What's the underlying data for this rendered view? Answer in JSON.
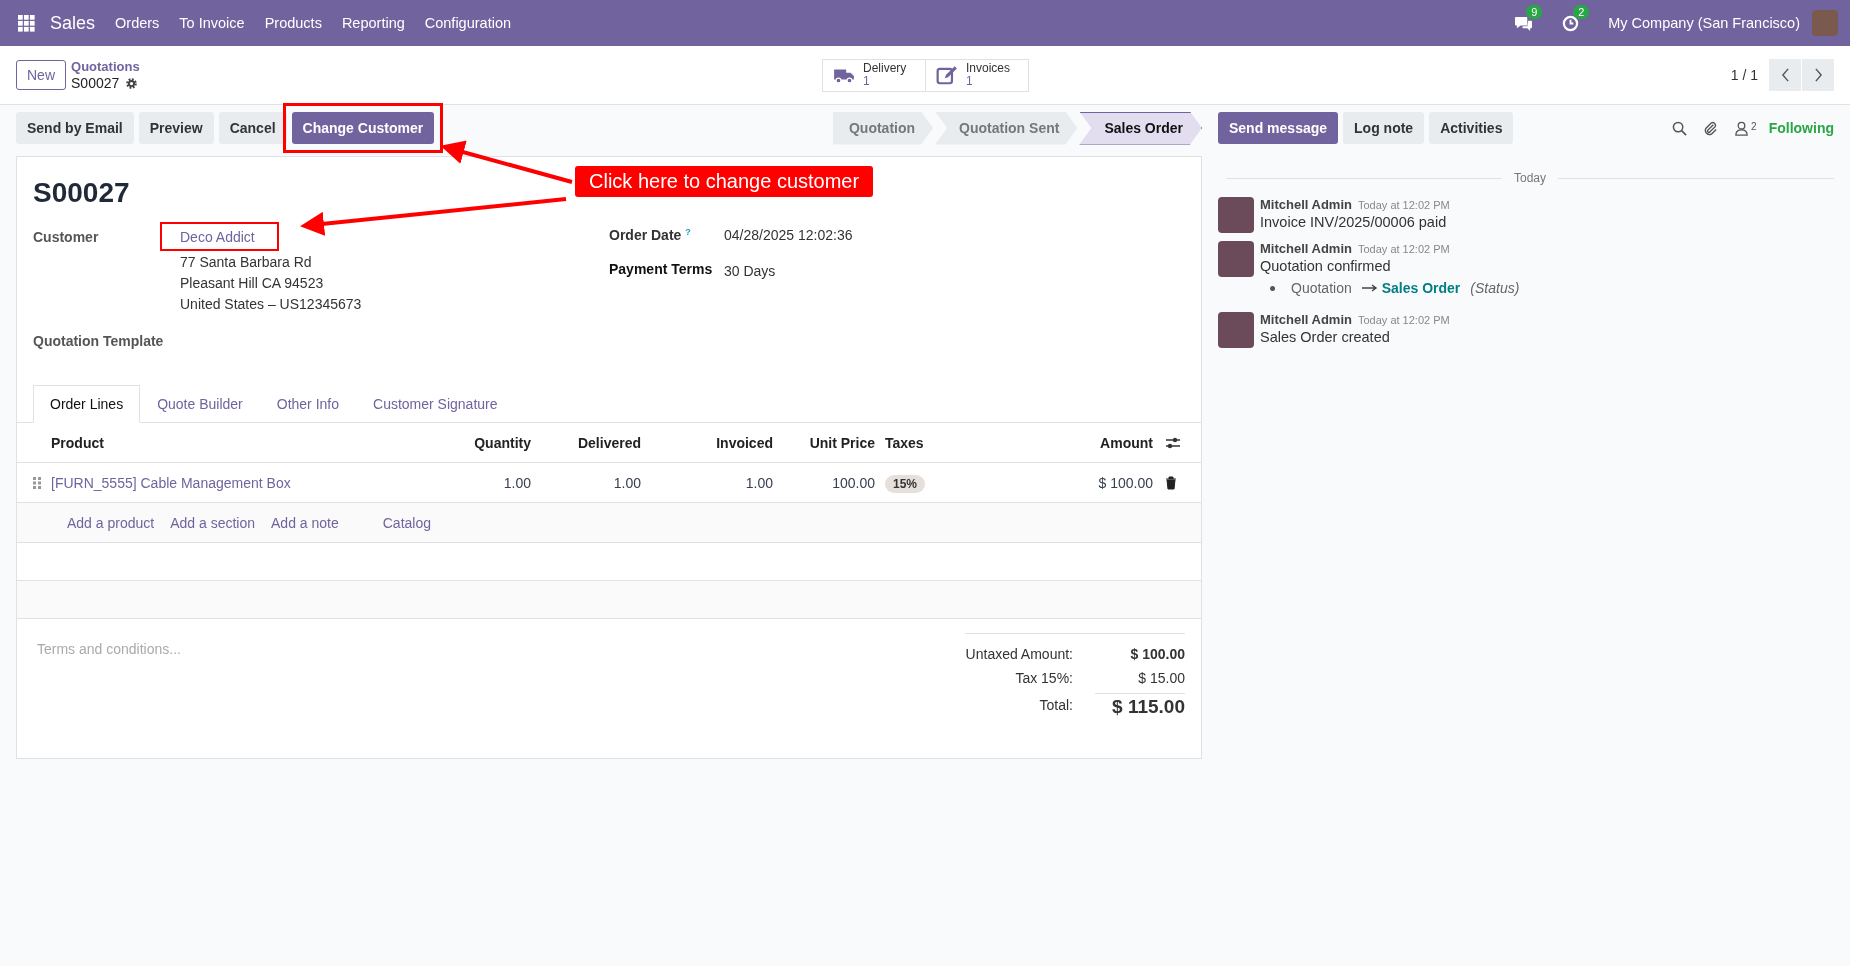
{
  "navbar": {
    "app": "Sales",
    "menu": [
      "Orders",
      "To Invoice",
      "Products",
      "Reporting",
      "Configuration"
    ],
    "messages_badge": "9",
    "activities_badge": "2",
    "company": "My Company (San Francisco)"
  },
  "control_panel": {
    "new_button": "New",
    "breadcrumb": "Quotations",
    "record": "S00027",
    "smart_buttons": [
      {
        "kind": "truck",
        "label": "Delivery",
        "count": "1"
      },
      {
        "kind": "edit",
        "label": "Invoices",
        "count": "1"
      }
    ],
    "pager": "1 / 1"
  },
  "actions": [
    {
      "label": "Send by Email",
      "primary": false,
      "highlighted": false
    },
    {
      "label": "Preview",
      "primary": false,
      "highlighted": false
    },
    {
      "label": "Cancel",
      "primary": false,
      "highlighted": false
    },
    {
      "label": "Change Customer",
      "primary": true,
      "highlighted": true
    }
  ],
  "statusbar": [
    {
      "label": "Quotation",
      "selected": false
    },
    {
      "label": "Quotation Sent",
      "selected": false
    },
    {
      "label": "Sales Order",
      "selected": true
    }
  ],
  "chatter_buttons": [
    {
      "label": "Send message",
      "primary": true
    },
    {
      "label": "Log note",
      "primary": false
    },
    {
      "label": "Activities",
      "primary": false
    }
  ],
  "followers_count": "2",
  "following": "Following",
  "form": {
    "name": "S00027",
    "customer_label": "Customer",
    "customer": "Deco Addict",
    "customer_highlighted": true,
    "address": [
      "77 Santa Barbara Rd",
      "Pleasant Hill CA 94523",
      "United States – US12345673"
    ],
    "order_date_label": "Order Date",
    "help_mark": "?",
    "order_date": "04/28/2025 12:02:36",
    "payment_terms_label": "Payment Terms",
    "payment_terms": "30 Days",
    "template_label": "Quotation Template"
  },
  "tabs": [
    {
      "label": "Order Lines",
      "selected": true
    },
    {
      "label": "Quote Builder",
      "selected": false
    },
    {
      "label": "Other Info",
      "selected": false
    },
    {
      "label": "Customer Signature",
      "selected": false
    }
  ],
  "table": {
    "columns": [
      "Product",
      "Quantity",
      "Delivered",
      "Invoiced",
      "Unit Price",
      "Taxes",
      "Amount"
    ],
    "rows": [
      {
        "product": "[FURN_5555] Cable Management Box",
        "quantity": "1.00",
        "delivered": "1.00",
        "invoiced": "1.00",
        "unit_price": "100.00",
        "taxes": "15%",
        "amount": "$ 100.00"
      }
    ],
    "add_links": [
      "Add a product",
      "Add a section",
      "Add a note",
      "Catalog"
    ]
  },
  "terms_placeholder": "Terms and conditions...",
  "totals": [
    {
      "label": "Untaxed Amount:",
      "value": "$ 100.00",
      "kind": "subtotal"
    },
    {
      "label": "Tax 15%:",
      "value": "$ 15.00",
      "kind": "tax"
    },
    {
      "label": "Total:",
      "value": "$ 115.00",
      "kind": "total"
    }
  ],
  "chatter": {
    "date_separator": "Today",
    "messages": [
      {
        "author": "Mitchell Admin",
        "time": "Today at 12:02 PM",
        "body": "Invoice INV/2025/00006 paid"
      },
      {
        "author": "Mitchell Admin",
        "time": "Today at 12:02 PM",
        "body": "Quotation confirmed",
        "tracking": {
          "old": "Quotation",
          "new": "Sales Order",
          "field": "(Status)"
        }
      },
      {
        "author": "Mitchell Admin",
        "time": "Today at 12:02 PM",
        "body": "Sales Order created"
      }
    ]
  },
  "annotation": {
    "callout": "Click here to change customer"
  }
}
